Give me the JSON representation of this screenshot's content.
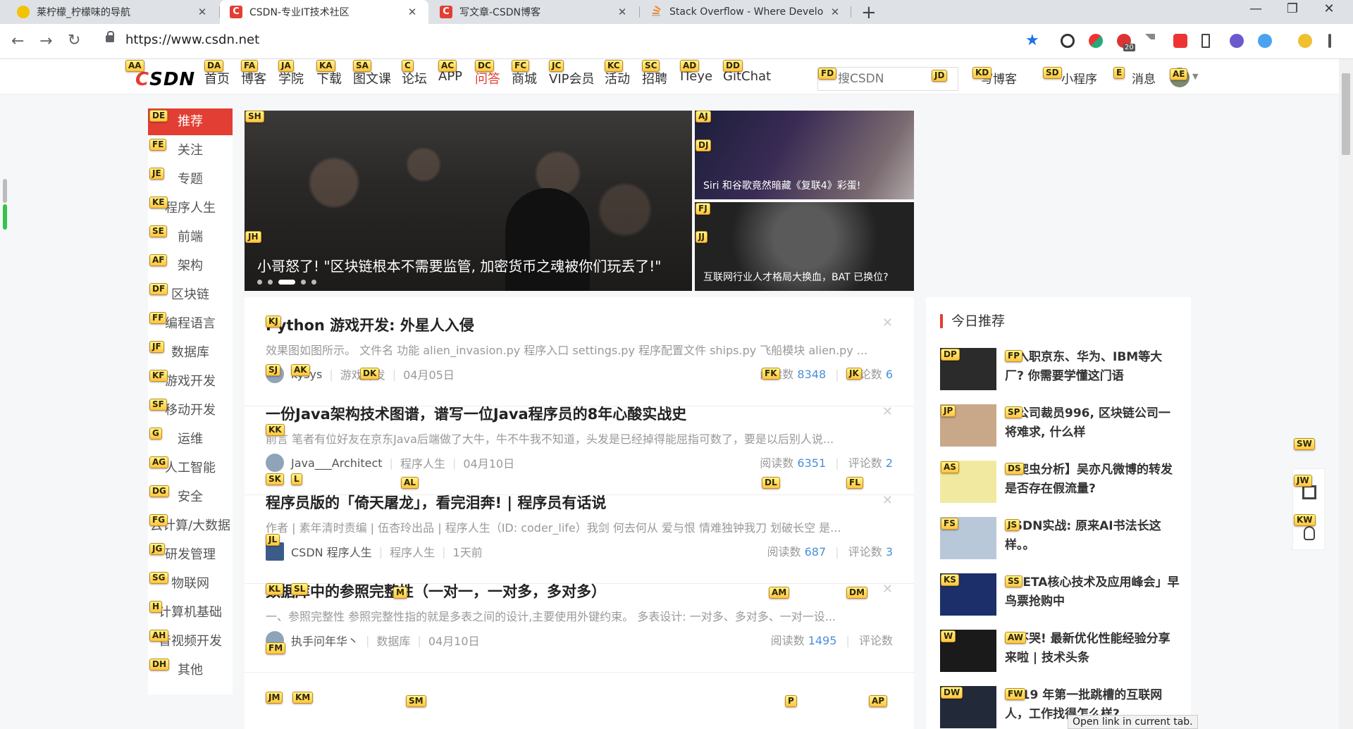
{
  "browser": {
    "tabs": [
      {
        "title": "莱柠檬_柠檬味的导航",
        "favicon": "lemon-icon",
        "active": false
      },
      {
        "title": "CSDN-专业IT技术社区",
        "favicon": "csdn-icon",
        "active": true
      },
      {
        "title": "写文章-CSDN博客",
        "favicon": "csdn-icon",
        "active": false
      },
      {
        "title": "Stack Overflow - Where Develo",
        "favicon": "stackoverflow-icon",
        "active": false
      }
    ],
    "url": "https://www.csdn.net",
    "extension_badge": "20"
  },
  "site": {
    "logo_prefix": "C",
    "logo_text": "SDN",
    "nav": [
      "首页",
      "博客",
      "学院",
      "下载",
      "图文课",
      "论坛",
      "APP",
      "问答",
      "商城",
      "VIP会员",
      "活动",
      "招聘",
      "ITeye",
      "GitChat"
    ],
    "search_placeholder": "搜CSDN",
    "header_links": {
      "write": "写博客",
      "mini": "小程序",
      "msg": "消息"
    }
  },
  "categories": [
    "推荐",
    "关注",
    "专题",
    "程序人生",
    "前端",
    "架构",
    "区块链",
    "编程语言",
    "数据库",
    "游戏开发",
    "移动开发",
    "运维",
    "人工智能",
    "安全",
    "云计算/大数据",
    "研发管理",
    "物联网",
    "计算机基础",
    "音视频开发",
    "其他"
  ],
  "carousel": {
    "main_caption": "小哥怒了! \"区块链根本不需要监管, 加密货币之魂被你们玩丢了!\"",
    "side1_caption": "Siri 和谷歌竟然暗藏《复联4》彩蛋!",
    "side2_caption": "互联网行业人才格局大换血，BAT 已换位?"
  },
  "feed": [
    {
      "title": "Python 游戏开发: 外星人入侵",
      "desc": "效果图如图所示。 文件名 功能 alien_invasion.py 程序入口 settings.py 程序配置文件 ships.py 飞船模块 alien.py ...",
      "author": "kysys",
      "tag": "游戏开发",
      "date": "04月05日",
      "read_label": "阅读数",
      "read": "8348",
      "comment_label": "评论数",
      "comments": "6"
    },
    {
      "title": "一份Java架构技术图谱，谱写一位Java程序员的8年心酸实战史",
      "desc": "前言 笔者有位好友在京东Java后端做了大牛，牛不牛我不知道，头发是已经掉得能屈指可数了，要是以后别人说...",
      "author": "Java___Architect",
      "tag": "程序人生",
      "date": "04月10日",
      "read_label": "阅读数",
      "read": "6351",
      "comment_label": "评论数",
      "comments": "2"
    },
    {
      "title": "程序员版的「倚天屠龙」，看完泪奔! | 程序员有话说",
      "desc": "作者 | 素年清时责编 | 伍杏玲出品 | 程序人生（ID: coder_life）我剑 何去何从 爱与恨 情难独钟我刀 划破长空 是...",
      "author": "CSDN 程序人生",
      "tag": "程序人生",
      "date": "1天前",
      "read_label": "阅读数",
      "read": "687",
      "comment_label": "评论数",
      "comments": "3"
    },
    {
      "title": "数据库中的参照完整性（一对一，一对多，多对多）",
      "desc": "一、参照完整性 参照完整性指的就是多表之间的设计,主要使用外键约束。 多表设计: 一对多、多对多、一对一设...",
      "author": "执手问年华丶",
      "tag": "数据库",
      "date": "04月10日",
      "read_label": "阅读数",
      "read": "1495",
      "comment_label": "评论数",
      "comments": ""
    }
  ],
  "recommend": {
    "heading": "今日推荐",
    "items": [
      "想入职京东、华为、IBM等大厂? 你需要学懂这门语",
      "大公司裁员996, 区块链公司一将难求, 什么样",
      "【爬虫分析】吴亦凡微博的转发是否存在假流量?",
      "CSDN实战: 原来AI书法长这样。。",
      "AI ETA核心技术及应用峰会」早鸟票抢购中",
      "绝不哭! 最新优化性能经验分享来啦 | 技术头条",
      "2019 年第一批跳槽的互联网人，工作找得怎么样?"
    ]
  },
  "status_tip": "Open link in current tab.",
  "hints": {
    "logo": "AA",
    "nav": [
      "DA",
      "FA",
      "JA",
      "KA",
      "SA",
      "C",
      "AC",
      "DC",
      "FC",
      "JC",
      "KC",
      "SC",
      "AD",
      "DD"
    ],
    "search_l": "FD",
    "search_r": "JD",
    "write": "KD",
    "mini": "SD",
    "msg": "E",
    "avatar": "AE",
    "cats": [
      "DE",
      "FE",
      "JE",
      "KE",
      "SE",
      "AF",
      "DF",
      "FF",
      "JF",
      "KF",
      "SF",
      "G",
      "AG",
      "DG",
      "FG",
      "JG",
      "SG",
      "H",
      "AH",
      "DH"
    ],
    "hero": "SH",
    "hero_cap": "JH",
    "sb1a": "AJ",
    "sb1b": "DJ",
    "sb2a": "FJ",
    "sb2b": "JJ",
    "feed": [
      [
        "KJ",
        "SJ",
        "AK",
        "DK",
        "FK",
        "JK"
      ],
      [
        "KK",
        "SK",
        "L",
        "AL",
        "DL",
        "FL"
      ],
      [
        "JL",
        "KL",
        "SL",
        "M",
        "AM",
        "DM"
      ],
      [
        "FM",
        "JM",
        "KM",
        "SM",
        "P",
        "AP"
      ]
    ],
    "rec": [
      [
        "DP",
        "FP"
      ],
      [
        "JP",
        "SP"
      ],
      [
        "AS",
        "DS"
      ],
      [
        "FS",
        "JS"
      ],
      [
        "KS",
        "SS"
      ],
      [
        "W",
        "AW"
      ],
      [
        "DW",
        "FW"
      ]
    ],
    "float": [
      "SW",
      "JW",
      "KW"
    ]
  }
}
